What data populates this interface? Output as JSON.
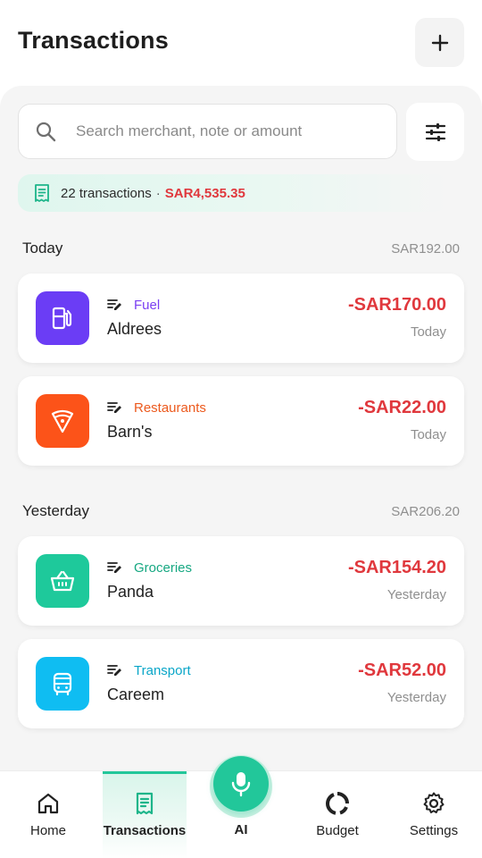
{
  "header": {
    "title": "Transactions",
    "add_icon": "plus-icon"
  },
  "search": {
    "placeholder": "Search merchant, note or amount",
    "value": ""
  },
  "summary": {
    "count_text": "22 transactions",
    "separator": "·",
    "total": "SAR4,535.35"
  },
  "colors": {
    "accent": "#22c79a",
    "expense": "#e0383d",
    "fuel": "#6b3df5",
    "restaurants": "#fc5319",
    "groceries": "#1ec99b",
    "transport": "#0fbdf2"
  },
  "sections": [
    {
      "title": "Today",
      "total": "SAR192.00",
      "transactions": [
        {
          "category": "Fuel",
          "merchant": "Aldrees",
          "amount": "-SAR170.00",
          "date": "Today",
          "icon": "fuel-pump-icon",
          "color": "#6b3df5",
          "label_color": "#7a3ff2"
        },
        {
          "category": "Restaurants",
          "merchant": "Barn's",
          "amount": "-SAR22.00",
          "date": "Today",
          "icon": "pizza-icon",
          "color": "#fc5319",
          "label_color": "#ec5a1e"
        }
      ]
    },
    {
      "title": "Yesterday",
      "total": "SAR206.20",
      "transactions": [
        {
          "category": "Groceries",
          "merchant": "Panda",
          "amount": "-SAR154.20",
          "date": "Yesterday",
          "icon": "basket-icon",
          "color": "#1ec99b",
          "label_color": "#17a882"
        },
        {
          "category": "Transport",
          "merchant": "Careem",
          "amount": "-SAR52.00",
          "date": "Yesterday",
          "icon": "bus-icon",
          "color": "#0fbdf2",
          "label_color": "#0aa6c8"
        }
      ]
    }
  ],
  "nav": {
    "items": [
      {
        "label": "Home",
        "icon": "home-icon"
      },
      {
        "label": "Transactions",
        "icon": "receipt-icon",
        "active": true
      },
      {
        "label": "AI",
        "icon": "microphone-icon"
      },
      {
        "label": "Budget",
        "icon": "donut-chart-icon"
      },
      {
        "label": "Settings",
        "icon": "gear-icon"
      }
    ]
  }
}
